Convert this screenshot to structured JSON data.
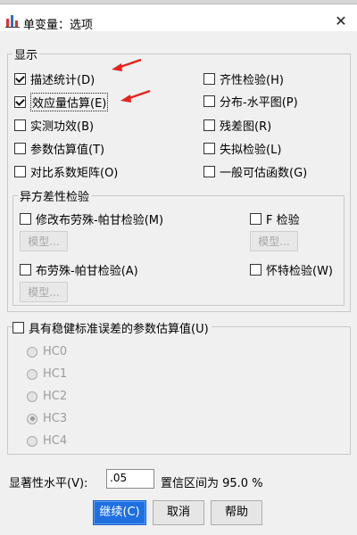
{
  "window": {
    "title": "单变量：选项",
    "close_glyph": "✕"
  },
  "display": {
    "legend": "显示",
    "left_options": [
      {
        "label": "描述统计(D)",
        "checked": true
      },
      {
        "label": "效应量估算(E)",
        "checked": true,
        "focused": true
      },
      {
        "label": "实测功效(B)",
        "checked": false
      },
      {
        "label": "参数估算值(T)",
        "checked": false
      },
      {
        "label": "对比系数矩阵(O)",
        "checked": false
      }
    ],
    "right_options": [
      {
        "label": "齐性检验(H)",
        "checked": false
      },
      {
        "label": "分布-水平图(P)",
        "checked": false
      },
      {
        "label": "残差图(R)",
        "checked": false
      },
      {
        "label": "失拟检验(L)",
        "checked": false
      },
      {
        "label": "一般可估函数(G)",
        "checked": false
      }
    ]
  },
  "hetero": {
    "legend": "异方差性检验",
    "modified_bp": "修改布劳殊-帕甘检验(M)",
    "f_test": "F 检验",
    "bp": "布劳殊-帕甘检验(A)",
    "white": "怀特检验(W)",
    "model_btn": "模型..."
  },
  "robust": {
    "label": "具有稳健标准误差的参数估算值(U)",
    "options": [
      "HC0",
      "HC1",
      "HC2",
      "HC3",
      "HC4"
    ],
    "selected": "HC3"
  },
  "significance": {
    "label": "显著性水平(V):",
    "value": ".05",
    "ci_text": "置信区间为 95.0 %"
  },
  "buttons": {
    "continue": "继续(C)",
    "cancel": "取消",
    "help": "帮助"
  },
  "colors": {
    "primary_button": "#1f6fe0",
    "annotation_arrow": "#e8221c"
  }
}
